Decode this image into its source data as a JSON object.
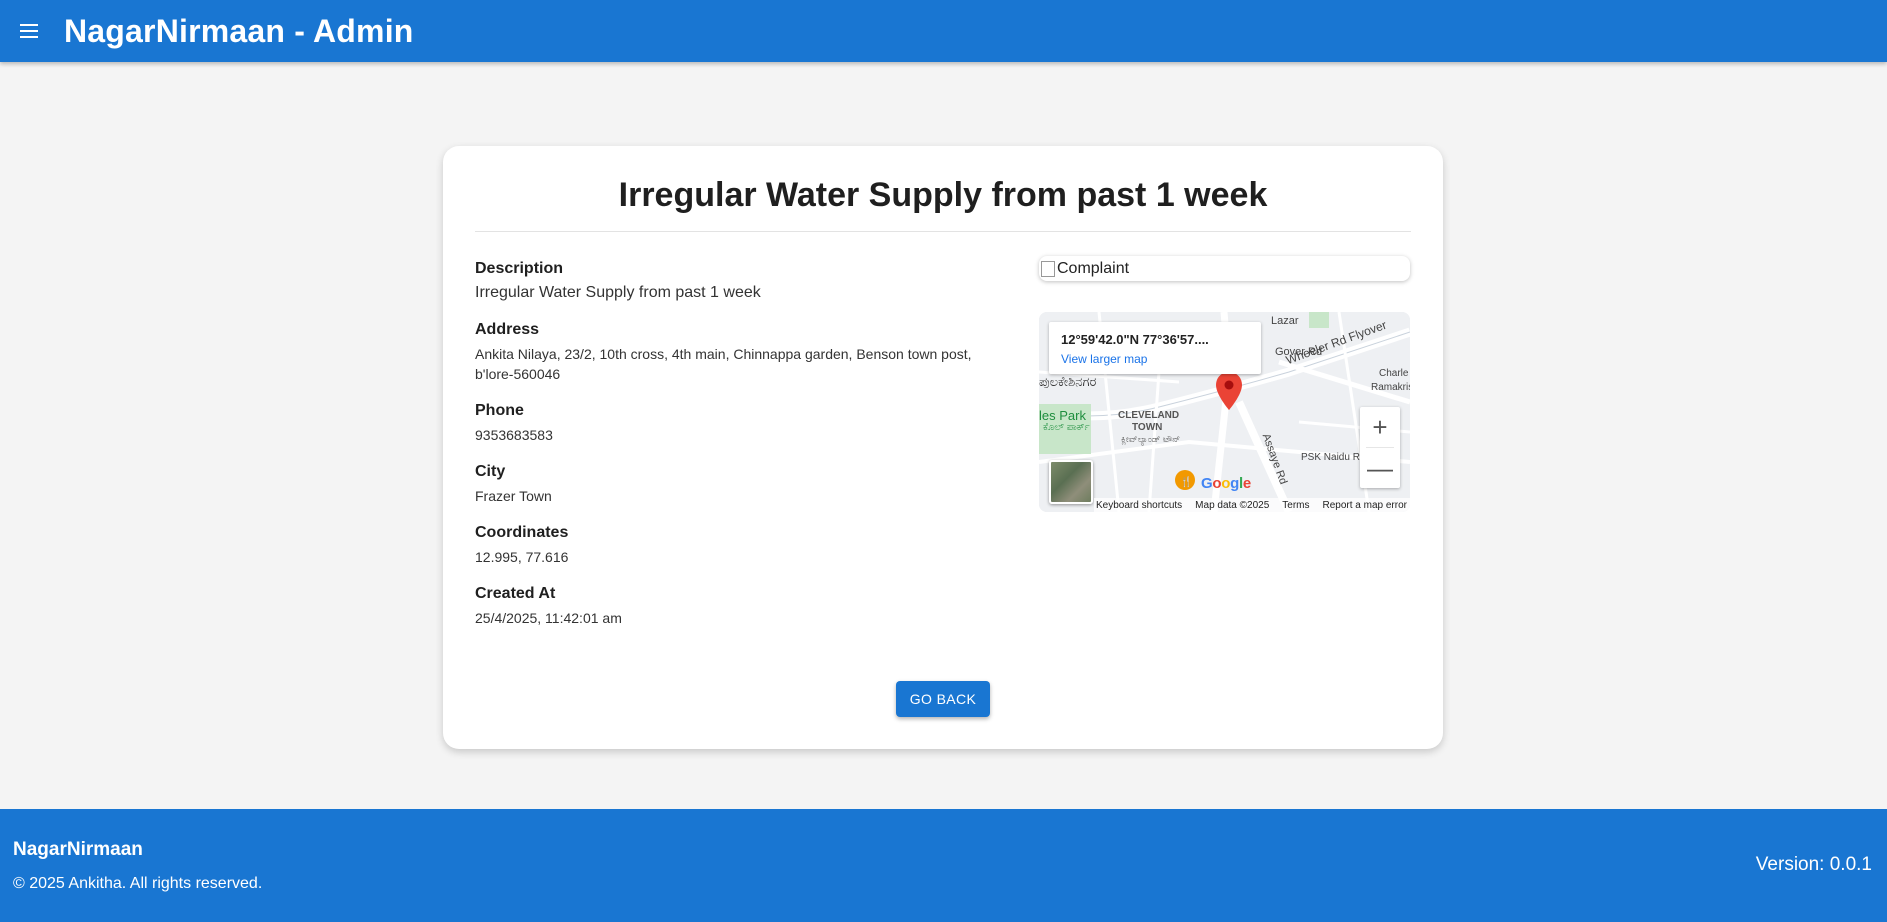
{
  "header": {
    "title": "NagarNirmaan - Admin",
    "menu_icon": "menu-icon"
  },
  "complaint": {
    "title": "Irregular Water Supply from past 1 week",
    "fields": [
      {
        "label": "Description",
        "value": "Irregular Water Supply from past 1 week"
      },
      {
        "label": "Address",
        "value": "Ankita Nilaya, 23/2, 10th cross, 4th main, Chinnappa garden, Benson town post, b'lore-560046"
      },
      {
        "label": "Phone",
        "value": "9353683583"
      },
      {
        "label": "City",
        "value": "Frazer Town"
      },
      {
        "label": "Coordinates",
        "value": "12.995, 77.616"
      },
      {
        "label": "Created At",
        "value": "25/4/2025, 11:42:01 am"
      }
    ],
    "image_alt": "Complaint",
    "go_back_label": "GO BACK"
  },
  "map": {
    "coords_text": "12°59'42.0\"N 77°36'57....",
    "view_larger": "View larger map",
    "zoom_in": "+",
    "zoom_out": "—",
    "logo": "Google",
    "footer": {
      "shortcuts": "Keyboard shortcuts",
      "data": "Map data ©2025",
      "terms": "Terms",
      "report": "Report a map error"
    },
    "labels": {
      "lazar": "Lazar",
      "gover": "Gover Rd",
      "wheeler": "Wheeler Rd Flyover",
      "kannada_place": "ಪುಲಕೇಶಿನಗರ",
      "park": "les Park",
      "park_kn": "ಕೊಲ್ ಪಾರ್ಕ್",
      "cleveland": "CLEVELAND",
      "town": "TOWN",
      "cleveland_kn": "ಕ್ಲೀವ್‌ಲ್ಯಾಂಡ್ ಟೌನ್",
      "assaye": "Assaye Rd",
      "psk": "PSK Naidu R",
      "ramakrishna": "Ramakris",
      "charles": "Charle"
    },
    "marker_color": "#ea4335"
  },
  "footer": {
    "brand": "NagarNirmaan",
    "copyright": "© 2025 Ankitha. All rights reserved.",
    "version": "Version: 0.0.1"
  },
  "colors": {
    "primary": "#1976d2",
    "background": "#f4f4f4"
  }
}
